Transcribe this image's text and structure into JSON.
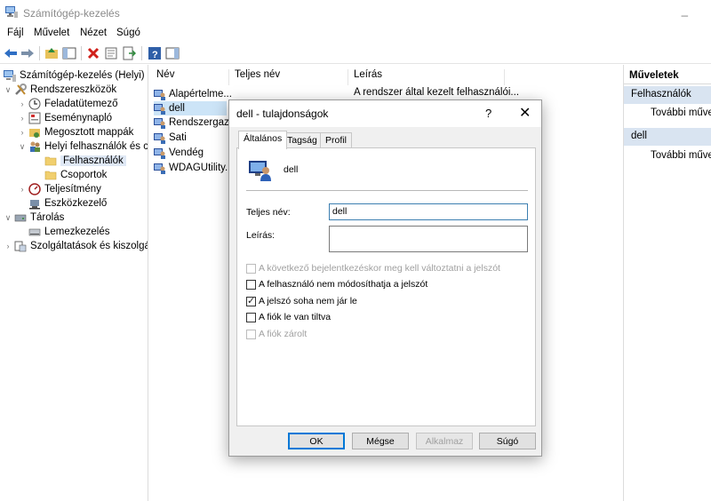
{
  "window": {
    "title": "Számítógép-kezelés"
  },
  "menu": [
    "Fájl",
    "Művelet",
    "Nézet",
    "Súgó"
  ],
  "tree": {
    "root": "Számítógép-kezelés (Helyi)",
    "system_tools": "Rendszereszközök",
    "task_scheduler": "Feladatütemező",
    "event_viewer": "Eseménynapló",
    "shared_folders": "Megosztott mappák",
    "local_users": "Helyi felhasználók és cs",
    "users": "Felhasználók",
    "groups": "Csoportok",
    "performance": "Teljesítmény",
    "device_manager": "Eszközkezelő",
    "storage": "Tárolás",
    "disk_management": "Lemezkezelés",
    "services": "Szolgáltatások és kiszolgáló"
  },
  "list": {
    "headers": [
      "Név",
      "Teljes név",
      "Leírás"
    ],
    "rows": [
      "Alapértelme...",
      "dell",
      "Rendszergaz...",
      "Sati",
      "Vendég",
      "WDAGUtility..."
    ],
    "first_row_description": "A rendszer által kezelt felhasználói..."
  },
  "actions": {
    "header": "Műveletek",
    "section1": "Felhasználók",
    "section1_item": "További művele",
    "section2": "dell",
    "section2_item": "További művele"
  },
  "dialog": {
    "title": "dell - tulajdonságok",
    "help": "?",
    "close": "✕",
    "tabs": [
      "Általános",
      "Tagság",
      "Profil"
    ],
    "username": "dell",
    "fullname_label": "Teljes név:",
    "fullname_value": "dell",
    "description_label": "Leírás:",
    "description_value": "",
    "checkboxes": {
      "must_change": "A következő bejelentkezéskor meg kell változtatni a jelszót",
      "cannot_change": "A felhasználó nem módosíthatja a jelszót",
      "never_expires": "A jelszó soha nem jár le",
      "disabled": "A fiók le van tiltva",
      "locked": "A fiók zárolt"
    },
    "buttons": {
      "ok": "OK",
      "cancel": "Mégse",
      "apply": "Alkalmaz",
      "help": "Súgó"
    }
  },
  "colors": {
    "selection": "#cce4f7",
    "accent": "#0078d7",
    "action_section": "#d9e4f1"
  }
}
